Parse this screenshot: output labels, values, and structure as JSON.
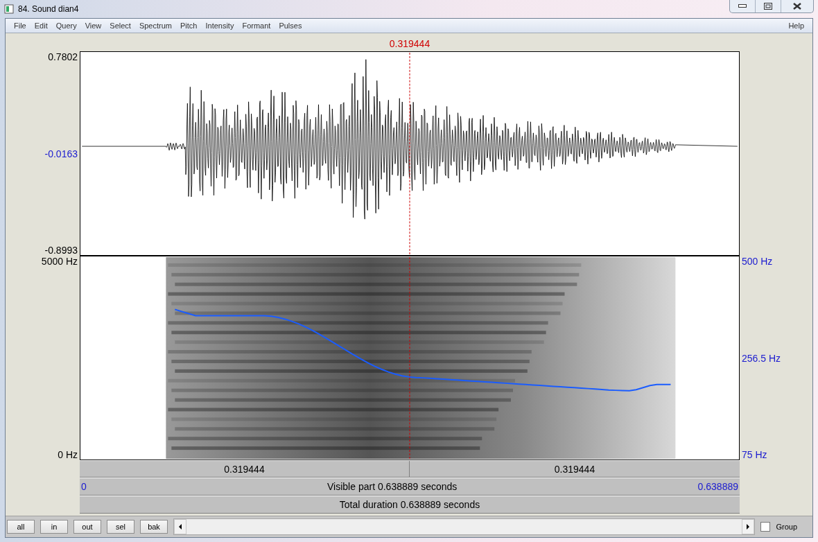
{
  "window": {
    "title": "84. Sound dian4"
  },
  "menu": [
    "File",
    "Edit",
    "Query",
    "View",
    "Select",
    "Spectrum",
    "Pitch",
    "Intensity",
    "Formant",
    "Pulses"
  ],
  "help": "Help",
  "cursor": {
    "time": "0.319444"
  },
  "waveform": {
    "ymax": "0.7802",
    "ymid": "-0.0163",
    "ymin": "-0.8993"
  },
  "spectrogram": {
    "ymax": "5000 Hz",
    "ymin": "0 Hz"
  },
  "pitch": {
    "ymax": "500 Hz",
    "ymid": "256.5 Hz",
    "ymin": "75 Hz"
  },
  "time_bars": {
    "left_segment": "0.319444",
    "right_segment": "0.319444",
    "start": "0",
    "visible": "Visible part 0.638889 seconds",
    "end": "0.638889",
    "total": "Total duration 0.638889 seconds"
  },
  "buttons": [
    "all",
    "in",
    "out",
    "sel",
    "bak"
  ],
  "group": {
    "label": "Group",
    "checked": false
  }
}
